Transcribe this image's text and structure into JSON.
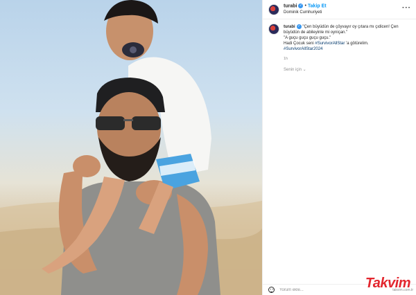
{
  "post": {
    "username": "turabi",
    "follow_label": "Takip Et",
    "location": "Dominik Cumhuriyeti"
  },
  "caption": {
    "username": "turabi",
    "line1": "\"Çen büyüdün de çöyvayır oy çıtara mı çıdicen! Çen büyüdün de abileyinle mi oyniçan.\"",
    "line2": "\"A guçu guçu guçu guçu.\"",
    "line3_pre": "Hadi Çocuk seni",
    "hashtag1": "#SurvivorAllStar",
    "line3_post": "'a götürelim.",
    "hashtag2": "#SurvivorAllStar2024",
    "time": "1h"
  },
  "for_you": "Senin için ⌄",
  "comment": {
    "placeholder": "Yorum ekle..."
  },
  "watermark": {
    "brand": "Takvim",
    "domain": "takvim.com.tr"
  },
  "icons": [
    "verified-icon",
    "more-icon",
    "emoji-icon"
  ],
  "colors": {
    "link": "#0095f6",
    "hashtag": "#00376b",
    "verified": "#3897f0",
    "brand": "#e3262e"
  }
}
